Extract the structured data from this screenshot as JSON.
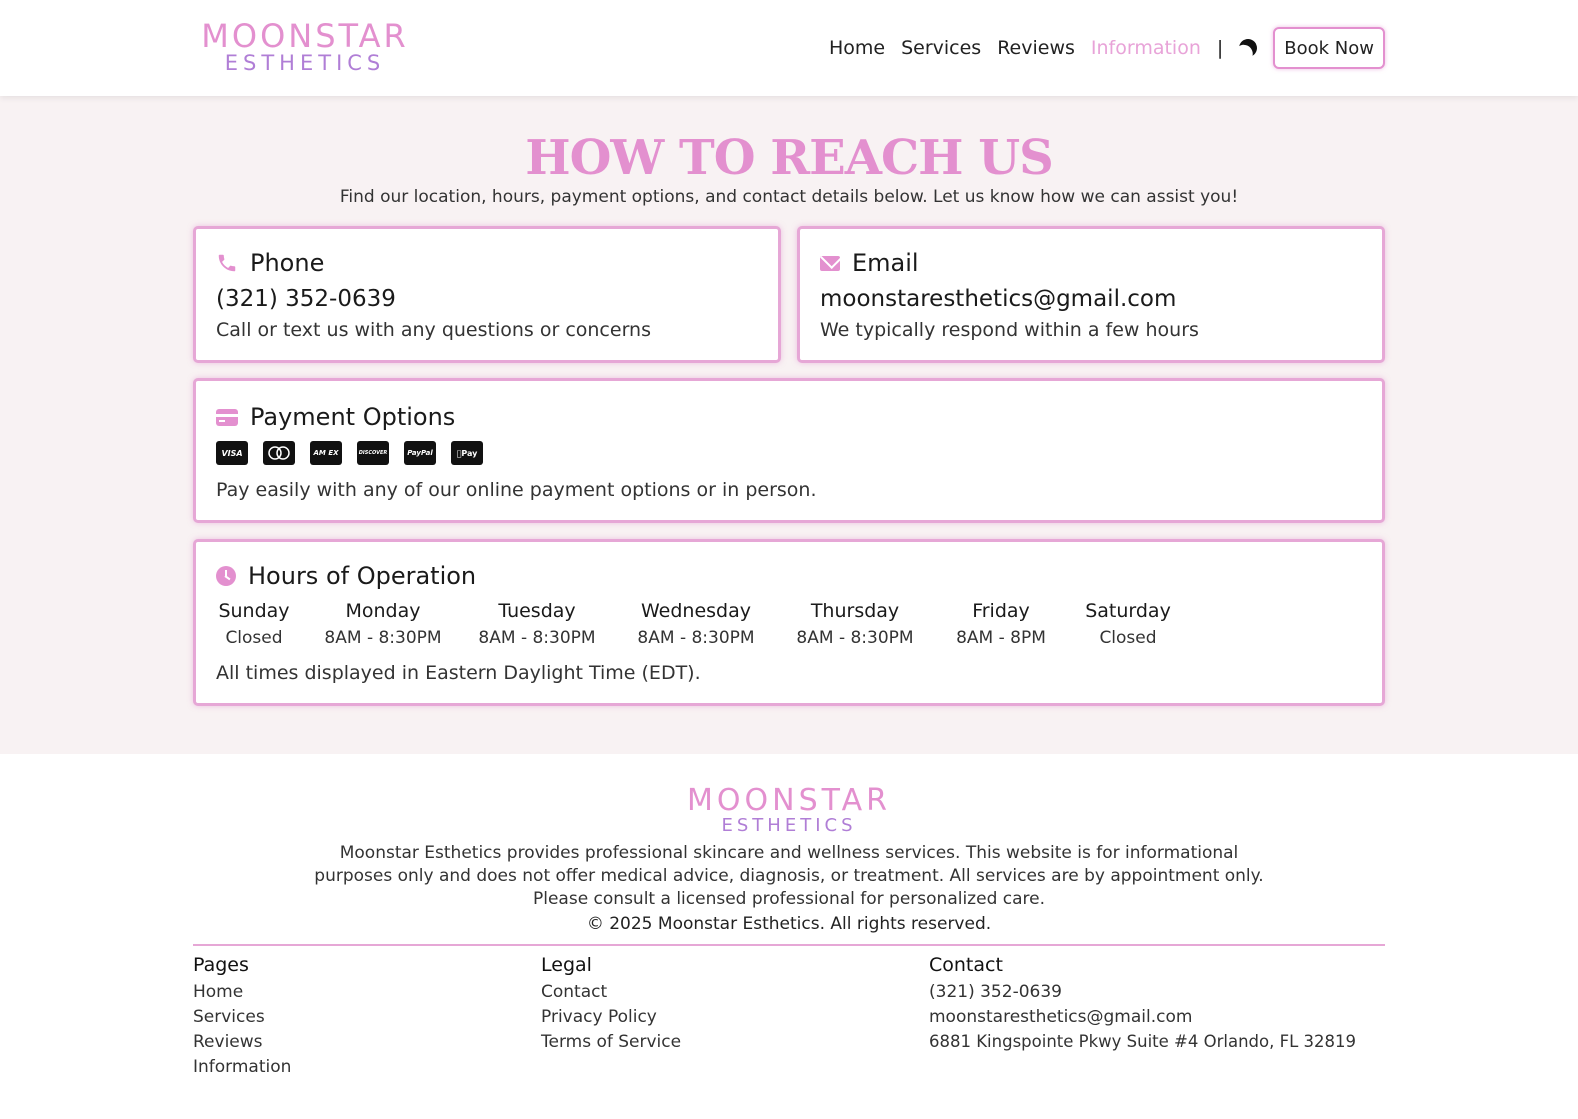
{
  "header": {
    "logo_top": "MOONSTAR",
    "logo_bottom": "ESTHETICS",
    "nav": [
      "Home",
      "Services",
      "Reviews",
      "Information"
    ],
    "active_nav": "Information",
    "separator": "|",
    "book_label": "Book Now"
  },
  "main": {
    "title": "HOW TO REACH US",
    "subtitle": "Find our location, hours, payment options, and contact details below. Let us know how we can assist you!",
    "phone": {
      "heading": "Phone",
      "value": "(321) 352-0639",
      "note": "Call or text us with any questions or concerns",
      "icon": "phone-icon"
    },
    "email": {
      "heading": "Email",
      "value": "moonstaresthetics@gmail.com",
      "note": "We typically respond within a few hours",
      "icon": "envelope-icon"
    },
    "payment": {
      "heading": "Payment Options",
      "icons": [
        "VISA",
        "MC",
        "AMEX",
        "DISCOVER",
        "PayPal",
        "Pay"
      ],
      "note": "Pay easily with any of our online payment options or in person.",
      "icon": "credit-card-icon"
    },
    "hours": {
      "heading": "Hours of Operation",
      "days": [
        {
          "day": "Sunday",
          "hours": "Closed"
        },
        {
          "day": "Monday",
          "hours": "8AM - 8:30PM"
        },
        {
          "day": "Tuesday",
          "hours": "8AM - 8:30PM"
        },
        {
          "day": "Wednesday",
          "hours": "8AM - 8:30PM"
        },
        {
          "day": "Thursday",
          "hours": "8AM - 8:30PM"
        },
        {
          "day": "Friday",
          "hours": "8AM - 8PM"
        },
        {
          "day": "Saturday",
          "hours": "Closed"
        }
      ],
      "note": "All times displayed in Eastern Daylight Time (EDT).",
      "icon": "clock-icon"
    }
  },
  "footer": {
    "logo_top": "MOONSTAR",
    "logo_bottom": "ESTHETICS",
    "disclaimer": "Moonstar Esthetics provides professional skincare and wellness services. This website is for informational purposes only and does not offer medical advice, diagnosis, or treatment. All services are by appointment only. Please consult a licensed professional for personalized care.",
    "copyright": "© 2025 Moonstar Esthetics. All rights reserved.",
    "pages": {
      "heading": "Pages",
      "items": [
        "Home",
        "Services",
        "Reviews",
        "Information"
      ]
    },
    "legal": {
      "heading": "Legal",
      "items": [
        "Contact",
        "Privacy Policy",
        "Terms of Service"
      ]
    },
    "contact": {
      "heading": "Contact",
      "items": [
        "(321) 352-0639",
        "moonstaresthetics@gmail.com",
        "6881 Kingspointe Pkwy Suite #4 Orlando, FL 32819"
      ]
    }
  },
  "colors": {
    "accent": "#e390cf",
    "secondary": "#b07ed6",
    "background": "#f8f2f3"
  }
}
